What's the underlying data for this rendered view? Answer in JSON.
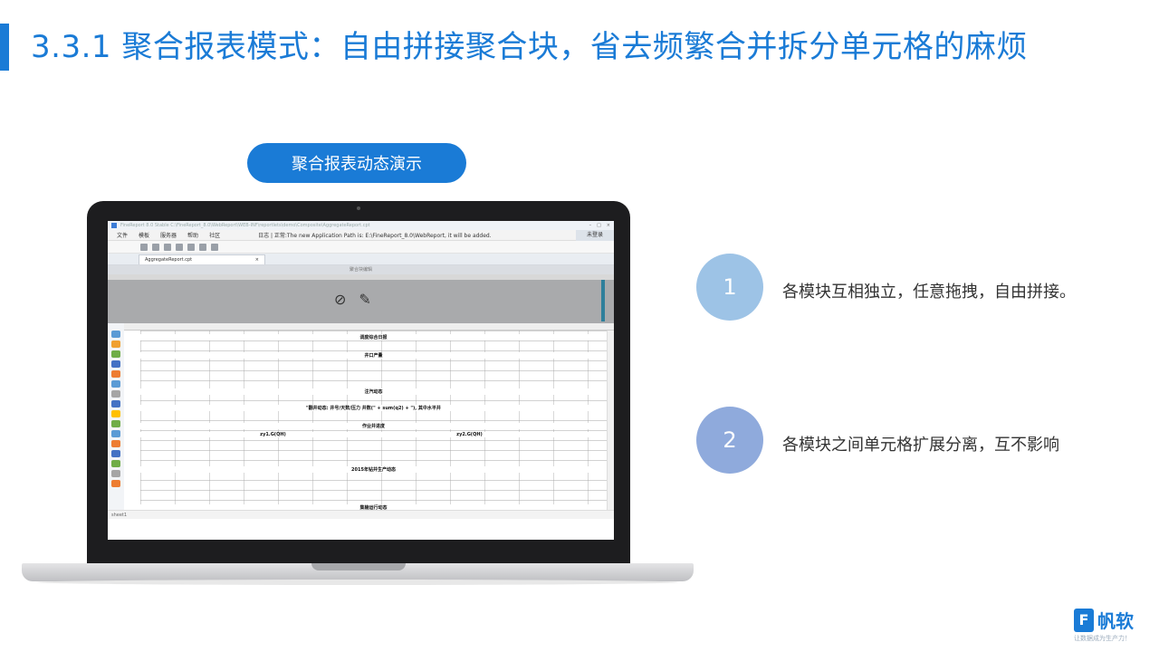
{
  "title": "3.3.1 聚合报表模式：自由拼接聚合块，省去频繁合并拆分单元格的麻烦",
  "demo_button": "聚合报表动态演示",
  "steps": [
    {
      "number": "1",
      "text": "各模块互相独立，任意拖拽，自由拼接。",
      "color": "#9dc3e6"
    },
    {
      "number": "2",
      "text": "各模块之间单元格扩展分离，互不影响",
      "color": "#8faadc"
    }
  ],
  "app": {
    "window_title": "FineReport 8.0 Stable  C:\\FineReport_8.0\\WebReport\\WEB-INF\\reportlets\\demo\\Composite\\AggregateReport.cpt",
    "menus": [
      "文件",
      "模板",
      "服务器",
      "帮助",
      "社区"
    ],
    "log_text": "日志 | 正常:The new  Application Path is: E:\\FineReport_8.0\\WebReport, it will be added.",
    "login_label": "未登录",
    "tab_name": "AggregateReport.cpt",
    "section_header": "聚合块编辑",
    "bands": [
      "调度综合日报",
      "井口产量",
      "注汽动态",
      "\"翻井动态: 井号/天数/压力    井数(\" + sum(q2) + \"), 其中水平井",
      "作业井进度",
      "zy1.G(QH)",
      "zy2.G(QH)",
      "2015年钻井生产动态",
      "集输运行动态"
    ],
    "status_sheet": "sheet1"
  },
  "brand": {
    "name": "帆软",
    "tagline": "让数据成为生产力！",
    "color": "#1a7bd6"
  }
}
